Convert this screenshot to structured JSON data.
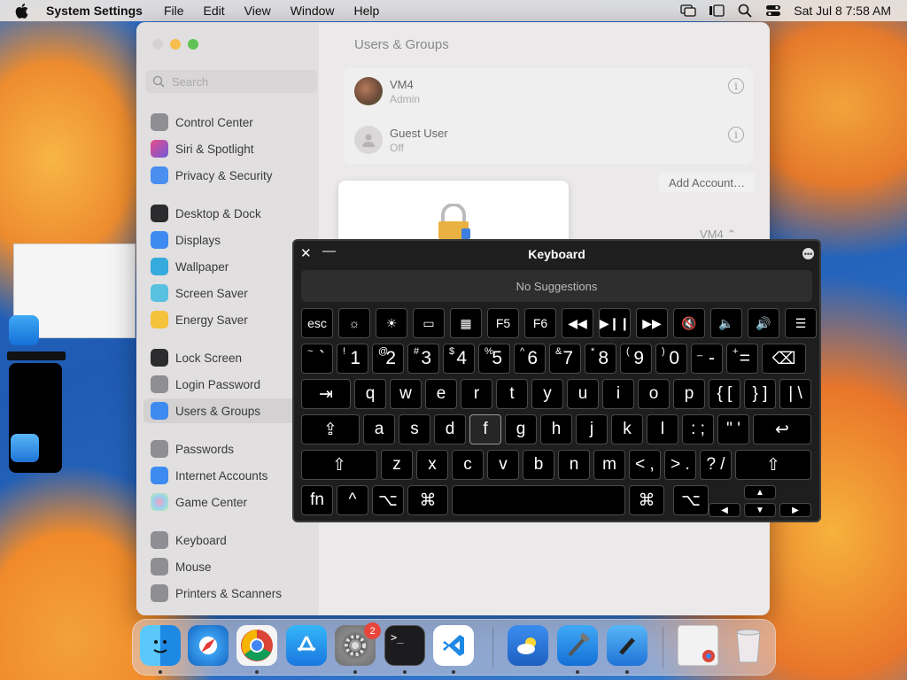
{
  "menubar": {
    "app_name": "System Settings",
    "items": [
      "File",
      "Edit",
      "View",
      "Window",
      "Help"
    ],
    "clock": "Sat Jul 8  7:58 AM"
  },
  "search": {
    "placeholder": "Search"
  },
  "sidebar": {
    "items": [
      {
        "label": "Control Center",
        "color": "#8e8e93"
      },
      {
        "label": "Siri & Spotlight",
        "color": "#b25bd6"
      },
      {
        "label": "Privacy & Security",
        "color": "#4a8ef0"
      },
      {
        "label": "Desktop & Dock",
        "color": "#1c1c1e"
      },
      {
        "label": "Displays",
        "color": "#3d8bf0"
      },
      {
        "label": "Wallpaper",
        "color": "#35aadc"
      },
      {
        "label": "Screen Saver",
        "color": "#58c1e0"
      },
      {
        "label": "Energy Saver",
        "color": "#f5c33b"
      },
      {
        "label": "Lock Screen",
        "color": "#1c1c1e"
      },
      {
        "label": "Login Password",
        "color": "#8e8e93"
      },
      {
        "label": "Users & Groups",
        "color": "#3d8bf0"
      },
      {
        "label": "Passwords",
        "color": "#8e8e93"
      },
      {
        "label": "Internet Accounts",
        "color": "#3d8bf0"
      },
      {
        "label": "Game Center",
        "color": "#e0e0e0"
      },
      {
        "label": "Keyboard",
        "color": "#8e8e93"
      },
      {
        "label": "Mouse",
        "color": "#8e8e93"
      },
      {
        "label": "Printers & Scanners",
        "color": "#8e8e93"
      }
    ]
  },
  "main": {
    "title": "Users & Groups",
    "users": [
      {
        "name": "VM4",
        "role": "Admin"
      },
      {
        "name": "Guest User",
        "role": "Off"
      }
    ],
    "add_account": "Add Account…",
    "auto_login_value": "VM4 ⌃"
  },
  "keyboard": {
    "title": "Keyboard",
    "suggestions": "No Suggestions",
    "fn_row": [
      "esc",
      "☼",
      "☀",
      "▭",
      "▦",
      "F5",
      "F6",
      "◀◀",
      "▶❙❙",
      "▶▶",
      "🔇",
      "🔈",
      "🔊",
      "☰"
    ],
    "row1": [
      {
        "s": "~",
        "m": "`"
      },
      {
        "s": "!",
        "m": "1"
      },
      {
        "s": "@",
        "m": "2"
      },
      {
        "s": "#",
        "m": "3"
      },
      {
        "s": "$",
        "m": "4"
      },
      {
        "s": "%",
        "m": "5"
      },
      {
        "s": "^",
        "m": "6"
      },
      {
        "s": "&",
        "m": "7"
      },
      {
        "s": "*",
        "m": "8"
      },
      {
        "s": "(",
        "m": "9"
      },
      {
        "s": ")",
        "m": "0"
      },
      {
        "s": "_",
        "m": "-"
      },
      {
        "s": "+",
        "m": "="
      },
      {
        "s": "",
        "m": "⌫"
      }
    ],
    "row2": [
      "⇥",
      "q",
      "w",
      "e",
      "r",
      "t",
      "y",
      "u",
      "i",
      "o",
      "p",
      "{ [",
      "} ]",
      "| \\"
    ],
    "row3": [
      "⇪",
      "a",
      "s",
      "d",
      "f",
      "g",
      "h",
      "j",
      "k",
      "l",
      ": ;",
      "\" '",
      "↩"
    ],
    "row4": [
      "⇧",
      "z",
      "x",
      "c",
      "v",
      "b",
      "n",
      "m",
      "< ,",
      "> .",
      "? /",
      "⇧"
    ],
    "row5": [
      "fn",
      "^",
      "⌥",
      "⌘",
      "",
      "⌘",
      "⌥",
      "▲",
      "◀",
      "▼",
      "▶"
    ]
  },
  "dock": {
    "apps": [
      "Finder",
      "Safari",
      "Chrome",
      "App Store",
      "System Settings",
      "Terminal",
      "VS Code",
      "Weather",
      "Xcode",
      "Simulator",
      "Preview",
      "Trash"
    ],
    "settings_badge": "2"
  }
}
